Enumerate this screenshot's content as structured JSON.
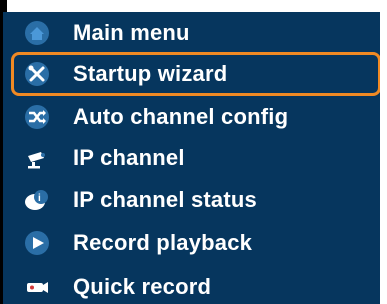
{
  "menu": {
    "items": [
      {
        "label": "Main menu",
        "icon": "home-icon"
      },
      {
        "label": "Startup wizard",
        "icon": "tools-icon"
      },
      {
        "label": "Auto channel config",
        "icon": "shuffle-icon"
      },
      {
        "label": "IP channel",
        "icon": "ip-camera-icon"
      },
      {
        "label": "IP channel status",
        "icon": "ip-status-icon"
      },
      {
        "label": "Record playback",
        "icon": "play-icon"
      },
      {
        "label": "Quick record",
        "icon": "camera-record-icon"
      }
    ],
    "selected_label": "Startup wizard"
  },
  "colors": {
    "panel_background": "#06365e",
    "highlight_border": "#f08a24",
    "text": "#ffffff",
    "icon_circle": "#2a6ea6"
  }
}
